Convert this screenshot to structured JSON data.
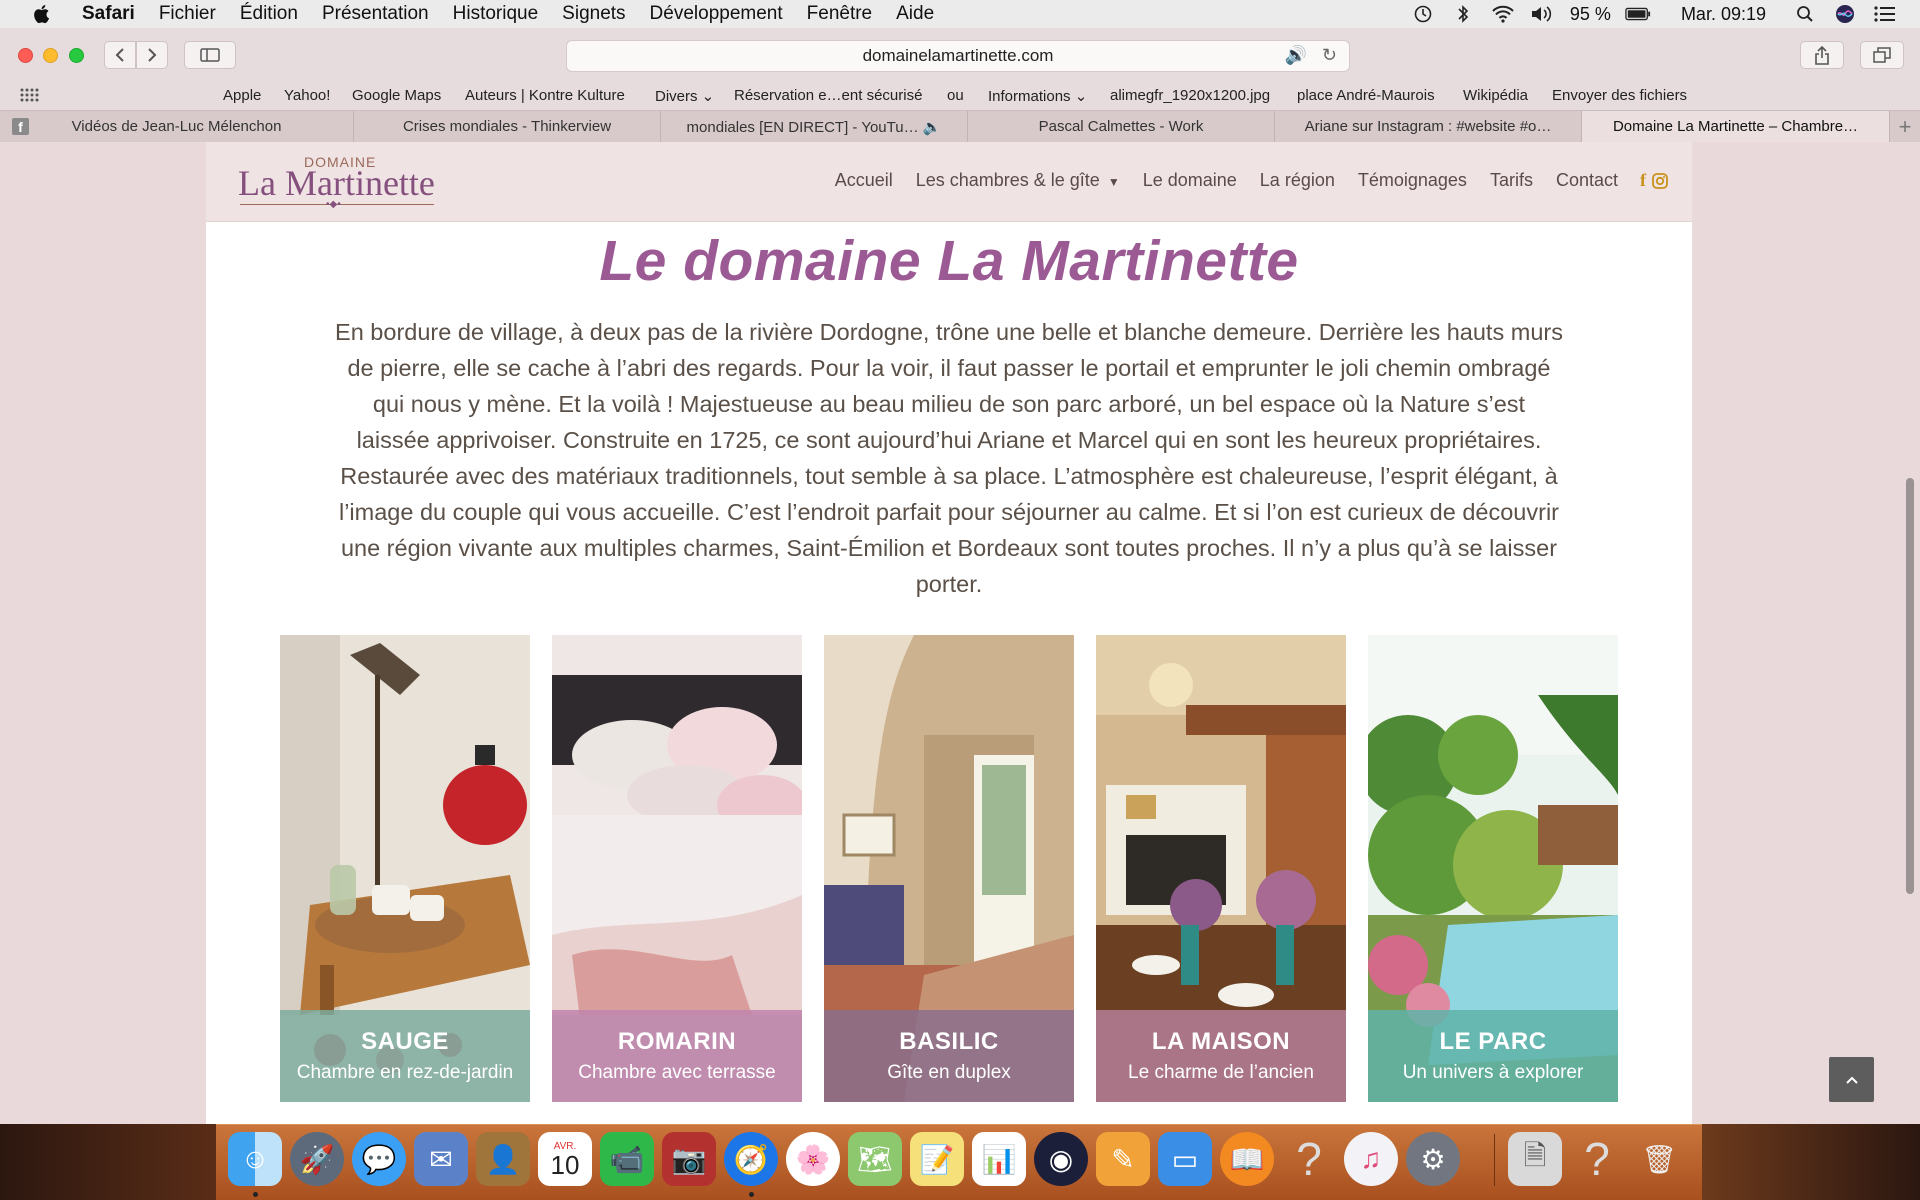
{
  "menubar": {
    "app": "Safari",
    "items": [
      "Fichier",
      "Édition",
      "Présentation",
      "Historique",
      "Signets",
      "Développement",
      "Fenêtre",
      "Aide"
    ],
    "battery": "95 %",
    "clock": "Mar. 09:19",
    "icons": [
      "apple-icon",
      "time-machine-icon",
      "bluetooth-icon",
      "wifi-icon",
      "volume-icon",
      "battery-icon",
      "spotlight-icon",
      "siri-icon",
      "notification-center-icon"
    ]
  },
  "toolbar": {
    "url": "domainelamartinette.com",
    "speaker_glyph": "🔊",
    "reload_glyph": "↻"
  },
  "bookmarks": [
    "Apple",
    "Yahoo!",
    "Google Maps",
    "Auteurs | Kontre Kulture",
    "Divers ⌄",
    "Réservation e…ent sécurisé",
    "ou",
    "Informations ⌄",
    "alimegfr_1920x1200.jpg",
    "place André-Maurois",
    "Wikipédia",
    "Envoyer des fichiers"
  ],
  "tabs": [
    {
      "label": "Vidéos de Jean-Luc Mélenchon"
    },
    {
      "label": "Crises mondiales - Thinkerview"
    },
    {
      "label": "mondiales [EN DIRECT] - YouTu… 🔈"
    },
    {
      "label": "Pascal Calmettes - Work"
    },
    {
      "label": "Ariane sur Instagram : #website #o…"
    },
    {
      "label": "Domaine La Martinette – Chambre…"
    }
  ],
  "site": {
    "logo_small": "DOMAINE",
    "logo_main": "La Martinette",
    "nav": [
      "Accueil",
      "Les chambres & le gîte",
      "Le domaine",
      "La région",
      "Témoignages",
      "Tarifs",
      "Contact"
    ],
    "title": "Le domaine La Martinette",
    "intro": "En bordure de village, à deux pas de la rivière Dordogne, trône une belle et blanche demeure. Derrière les hauts murs de pierre, elle se cache à l’abri des regards. Pour la voir, il faut passer le portail et emprunter le joli chemin ombragé qui nous y mène. Et la voilà ! Majestueuse au beau milieu de son parc arboré, un bel espace où la Nature s’est laissée apprivoiser. Construite en 1725, ce sont aujourd’hui Ariane et Marcel qui en sont les heureux propriétaires. Restaurée avec des matériaux traditionnels, tout semble à sa place. L’atmosphère est chaleureuse, l’esprit élégant, à l’image du couple qui vous accueille. C’est l’endroit parfait pour séjourner au calme. Et si l’on est curieux de découvrir une région vivante aux multiples charmes, Saint-Émilion et Bordeaux sont toutes proches. Il n’y a plus qu’à se laisser porter.",
    "cards": [
      {
        "title": "SAUGE",
        "subtitle": "Chambre en rez-de-jardin",
        "overlay": "#7eab9f"
      },
      {
        "title": "ROMARIN",
        "subtitle": "Chambre avec terrasse",
        "overlay": "#c084ad"
      },
      {
        "title": "BASILIC",
        "subtitle": "Gîte en duplex",
        "overlay": "#8b6f8c"
      },
      {
        "title": "LA MAISON",
        "subtitle": "Le charme de l’ancien",
        "overlay": "#b57f99"
      },
      {
        "title": "LE PARC",
        "subtitle": "Un univers à explorer",
        "overlay": "#5fb3a8"
      }
    ]
  },
  "dock": {
    "calendar_month": "AVR.",
    "calendar_day": "10"
  },
  "colors": {
    "accent": "#9b5a93",
    "body_text": "#5a5048",
    "header_bg": "#efe3e3",
    "page_bg": "#ead9da"
  }
}
